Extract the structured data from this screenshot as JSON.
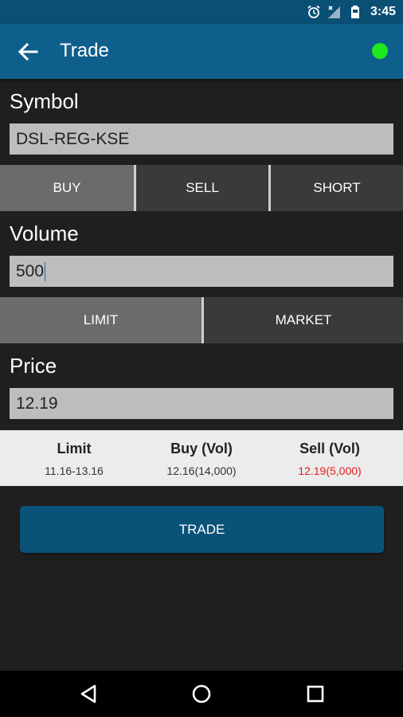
{
  "status_bar": {
    "time": "3:45",
    "icons": [
      "alarm-icon",
      "signal-off-icon",
      "battery-icon"
    ]
  },
  "app_bar": {
    "title": "Trade",
    "back_icon": "arrow-left-icon",
    "connection_status_color": "#1ee81e"
  },
  "symbol": {
    "label": "Symbol",
    "value": "DSL-REG-KSE"
  },
  "side_tabs": [
    {
      "label": "BUY",
      "active": true
    },
    {
      "label": "SELL",
      "active": false
    },
    {
      "label": "SHORT",
      "active": false
    }
  ],
  "volume": {
    "label": "Volume",
    "value": "500"
  },
  "order_type_tabs": [
    {
      "label": "LIMIT",
      "active": true
    },
    {
      "label": "MARKET",
      "active": false
    }
  ],
  "price": {
    "label": "Price",
    "value": "12.19"
  },
  "market_info": {
    "limit": {
      "header": "Limit",
      "value": "11.16-13.16"
    },
    "buy": {
      "header": "Buy (Vol)",
      "value": "12.16(14,000)"
    },
    "sell": {
      "header": "Sell (Vol)",
      "value": "12.19(5,000)",
      "color": "#e51b1b"
    }
  },
  "trade_button": {
    "label": "TRADE"
  },
  "nav_bar": {
    "icons": [
      "back-triangle-icon",
      "home-circle-icon",
      "recents-square-icon"
    ]
  },
  "colors": {
    "app_bar": "#0f5f8c",
    "status_bar": "#0a4f74",
    "background": "#1f1f1f",
    "trade_button": "#0a5278"
  }
}
